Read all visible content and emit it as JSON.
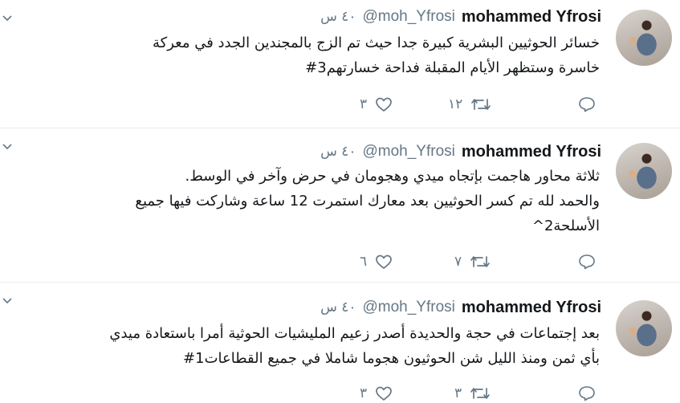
{
  "tweets": [
    {
      "name": "mohammed Yfrosi",
      "handle": "@moh_Yfrosi",
      "time": "٤٠ س",
      "lines": [
        "خسائر الحوثيين البشرية كبيرة جدا حيث تم الزج بالمجندين الجدد في معركة",
        "خاسرة وستظهر الأيام المقبلة فداحة خسارتهم3#"
      ],
      "retweets": "١٢",
      "likes": "٣"
    },
    {
      "name": "mohammed Yfrosi",
      "handle": "@moh_Yfrosi",
      "time": "٤٠ س",
      "lines": [
        "ثلاثة محاور هاجمت بإتجاه ميدي وهجومان في حرض وآخر في الوسط.",
        "والحمد لله تم كسر الحوثيين بعد معارك استمرت 12 ساعة وشاركت فيها جميع",
        "الأسلحة2^"
      ],
      "retweets": "٧",
      "likes": "٦"
    },
    {
      "name": "mohammed Yfrosi",
      "handle": "@moh_Yfrosi",
      "time": "٤٠ س",
      "lines": [
        "بعد إجتماعات في حجة والحديدة أصدر زعيم المليشيات الحوثية أمرا باستعادة ميدي",
        "بأي ثمن ومنذ الليل شن الحوثيون هجوما شاملا في جميع القطاعات1#"
      ],
      "retweets": "٣",
      "likes": "٣"
    }
  ],
  "icons": {
    "reply": "reply-icon",
    "retweet": "retweet-icon",
    "like": "heart-icon",
    "menu": "chevron-down-icon"
  },
  "colors": {
    "text": "#14171a",
    "muted": "#657786",
    "separator": "#e6ecf0"
  }
}
